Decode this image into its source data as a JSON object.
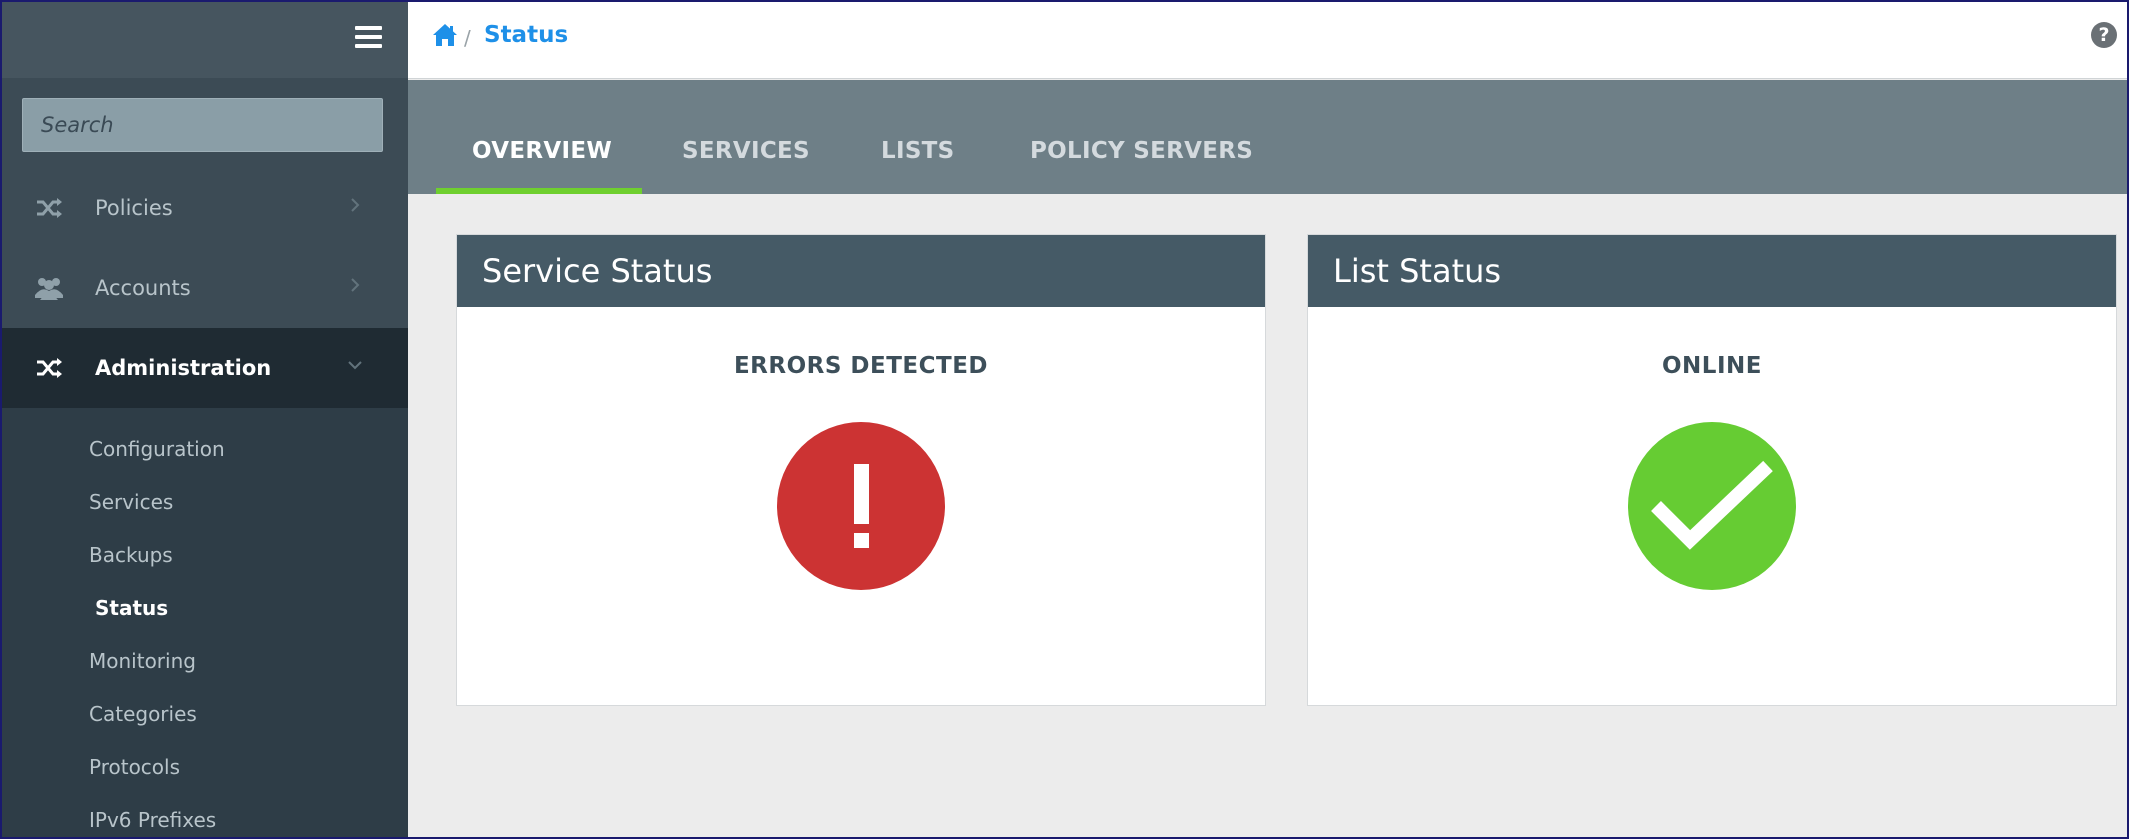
{
  "sidebar": {
    "search_placeholder": "Search",
    "nav": [
      {
        "label": "Policies",
        "icon": "shuffle-icon"
      },
      {
        "label": "Accounts",
        "icon": "users-icon"
      },
      {
        "label": "Administration",
        "icon": "shuffle-icon"
      }
    ],
    "submenu": [
      {
        "label": "Configuration"
      },
      {
        "label": "Services"
      },
      {
        "label": "Backups"
      },
      {
        "label": "Status"
      },
      {
        "label": "Monitoring"
      },
      {
        "label": "Categories"
      },
      {
        "label": "Protocols"
      },
      {
        "label": "IPv6 Prefixes"
      }
    ]
  },
  "breadcrumb": {
    "separator": "/",
    "current": "Status"
  },
  "tabs": [
    {
      "label": "OVERVIEW"
    },
    {
      "label": "SERVICES"
    },
    {
      "label": "LISTS"
    },
    {
      "label": "POLICY SERVERS"
    }
  ],
  "cards": [
    {
      "title": "Service Status",
      "status": "ERRORS DETECTED",
      "icon": "error-icon",
      "color": "#cc3333"
    },
    {
      "title": "List Status",
      "status": "ONLINE",
      "icon": "check-icon",
      "color": "#66cc33"
    }
  ],
  "colors": {
    "accent": "#1e90e8",
    "tab_active_underline": "#6fcf2f"
  }
}
